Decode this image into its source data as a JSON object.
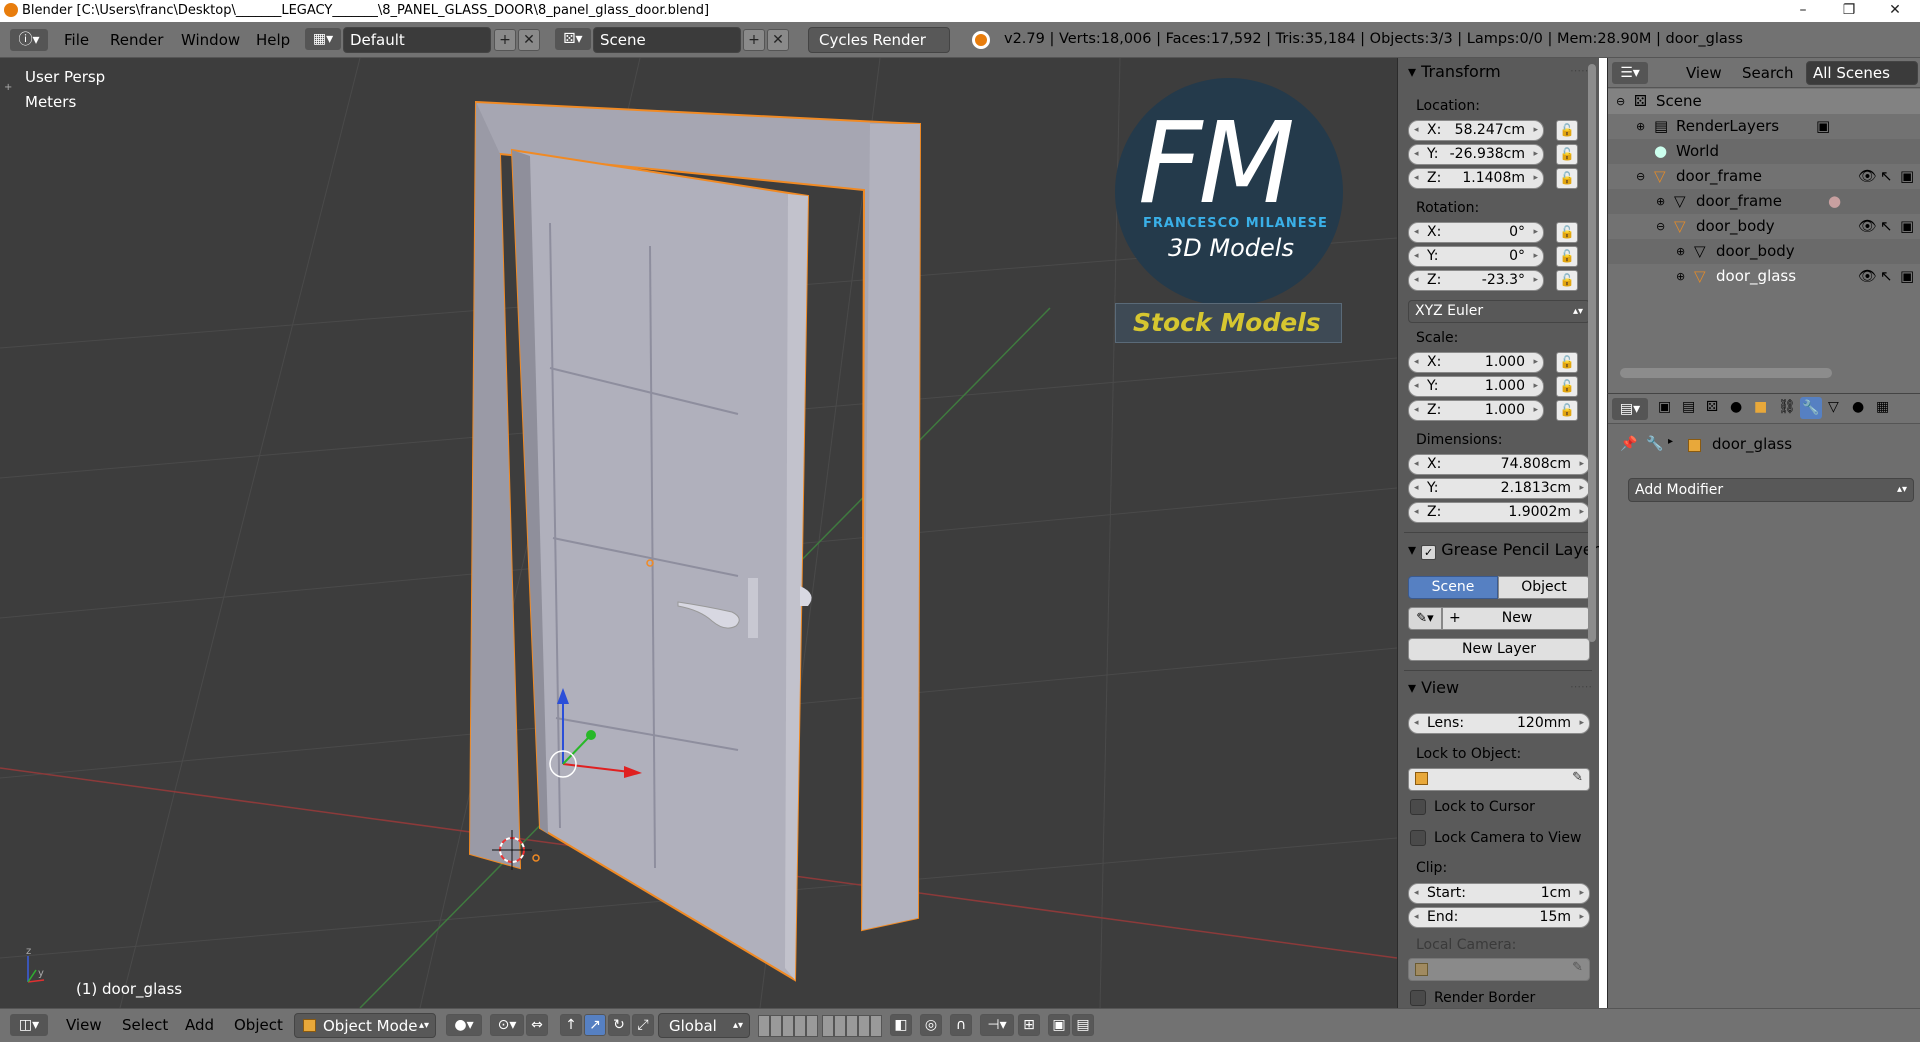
{
  "window": {
    "title": "Blender  [C:\\Users\\franc\\Desktop\\_______LEGACY_______\\8_PANEL_GLASS_DOOR\\8_panel_glass_door.blend]",
    "minimize": "–",
    "maximize": "❐",
    "close": "✕"
  },
  "header": {
    "menus": [
      "File",
      "Render",
      "Window",
      "Help"
    ],
    "layout": "Default",
    "scene": "Scene",
    "engine": "Cycles Render",
    "stats": "v2.79 | Verts:18,006 | Faces:17,592 | Tris:35,184 | Objects:3/3 | Lamps:0/0 | Mem:28.90M | door_glass"
  },
  "viewport": {
    "view_name": "User Persp",
    "units": "Meters",
    "active_object": "(1) door_glass",
    "logo_letters": "FM",
    "logo_name": "FRANCESCO MILANESE",
    "logo_sub": "3D Models",
    "banner": "Stock Models"
  },
  "transform": {
    "title": "Transform",
    "location_label": "Location:",
    "location": [
      {
        "axis": "X:",
        "value": "58.247cm"
      },
      {
        "axis": "Y:",
        "value": "-26.938cm"
      },
      {
        "axis": "Z:",
        "value": "1.1408m"
      }
    ],
    "rotation_label": "Rotation:",
    "rotation": [
      {
        "axis": "X:",
        "value": "0°"
      },
      {
        "axis": "Y:",
        "value": "0°"
      },
      {
        "axis": "Z:",
        "value": "-23.3°"
      }
    ],
    "rotation_mode": "XYZ Euler",
    "scale_label": "Scale:",
    "scale": [
      {
        "axis": "X:",
        "value": "1.000"
      },
      {
        "axis": "Y:",
        "value": "1.000"
      },
      {
        "axis": "Z:",
        "value": "1.000"
      }
    ],
    "dimensions_label": "Dimensions:",
    "dimensions": [
      {
        "axis": "X:",
        "value": "74.808cm"
      },
      {
        "axis": "Y:",
        "value": "2.1813cm"
      },
      {
        "axis": "Z:",
        "value": "1.9002m"
      }
    ]
  },
  "grease_pencil": {
    "title": "Grease Pencil Layer",
    "tab_scene": "Scene",
    "tab_object": "Object",
    "new": "New",
    "new_layer": "New Layer"
  },
  "view_panel": {
    "title": "View",
    "lens_label": "Lens:",
    "lens": "120mm",
    "lock_object_label": "Lock to Object:",
    "lock_cursor": "Lock to Cursor",
    "lock_camera": "Lock Camera to View",
    "clip_label": "Clip:",
    "clip_start_label": "Start:",
    "clip_start": "1cm",
    "clip_end_label": "End:",
    "clip_end": "15m",
    "local_camera_label": "Local Camera:",
    "render_border": "Render Border"
  },
  "outliner": {
    "view": "View",
    "search": "Search",
    "filter": "All Scenes",
    "items": [
      {
        "label": "Scene"
      },
      {
        "label": "RenderLayers"
      },
      {
        "label": "World"
      },
      {
        "label": "door_frame"
      },
      {
        "label": "door_frame"
      },
      {
        "label": "door_body"
      },
      {
        "label": "door_body"
      },
      {
        "label": "door_glass"
      }
    ]
  },
  "properties": {
    "object": "door_glass",
    "add_modifier": "Add Modifier"
  },
  "footer": {
    "menus": [
      "View",
      "Select",
      "Add",
      "Object"
    ],
    "mode": "Object Mode",
    "orientation": "Global"
  },
  "colors": {
    "viewport_bg": "#3d3d3d",
    "header_bg": "#727272",
    "panel_bg": "#5a5a5a",
    "selection_orange": "#f08a24",
    "active_blue": "#5680c2",
    "banner_yellow": "#d6c630"
  }
}
